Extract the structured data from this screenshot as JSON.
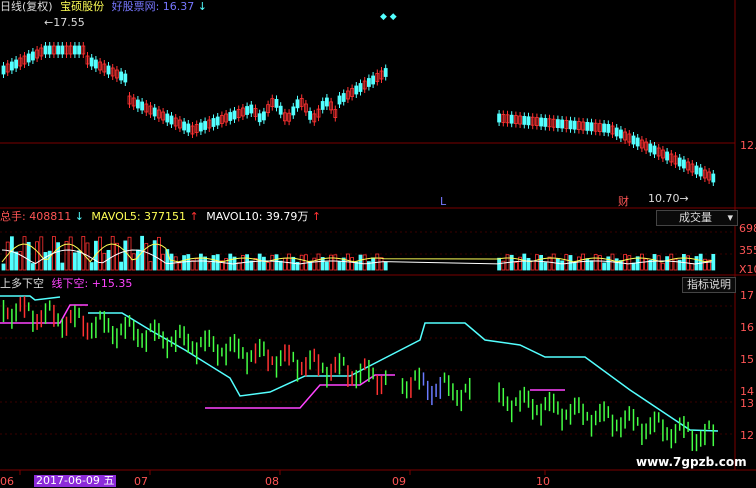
{
  "price_panel": {
    "period_label": "日线(复权)",
    "stock_name": "宝硕股份",
    "source_label": "好股票网: 16.37",
    "source_arrow": "↓",
    "high_marker": "←17.55",
    "low_marker": "10.70→",
    "axis_label": "12.",
    "letter_l": "L",
    "event_tag": "财"
  },
  "volume_panel": {
    "total_label": "总手: 408811",
    "total_arrow": "↓",
    "mavol5_label": "MAVOL5: 377151",
    "mavol5_arrow": "↑",
    "mavol10_label": "MAVOL10: 39.79万",
    "mavol10_arrow": "↑",
    "selector_value": "成交量",
    "selector_arrow": "▾",
    "axis_ticks": [
      "698",
      "355",
      "X10"
    ]
  },
  "indicator_panel": {
    "title": "上多下空",
    "line_label": "线下空: +15.35",
    "explain_button": "指标说明",
    "axis_ticks": [
      "17",
      "16",
      "15",
      "14",
      "13",
      "12"
    ]
  },
  "time_axis": {
    "labels": [
      "06",
      "2017-06-09 五",
      "07",
      "08",
      "09",
      "10"
    ]
  },
  "watermark": "www.7gpzb.com",
  "colors": {
    "up": "#ff3232",
    "down": "#54ffff",
    "grid": "#7a0000",
    "yellow": "#ffff55",
    "magenta": "#ff44ff",
    "green": "#44ff44"
  }
}
